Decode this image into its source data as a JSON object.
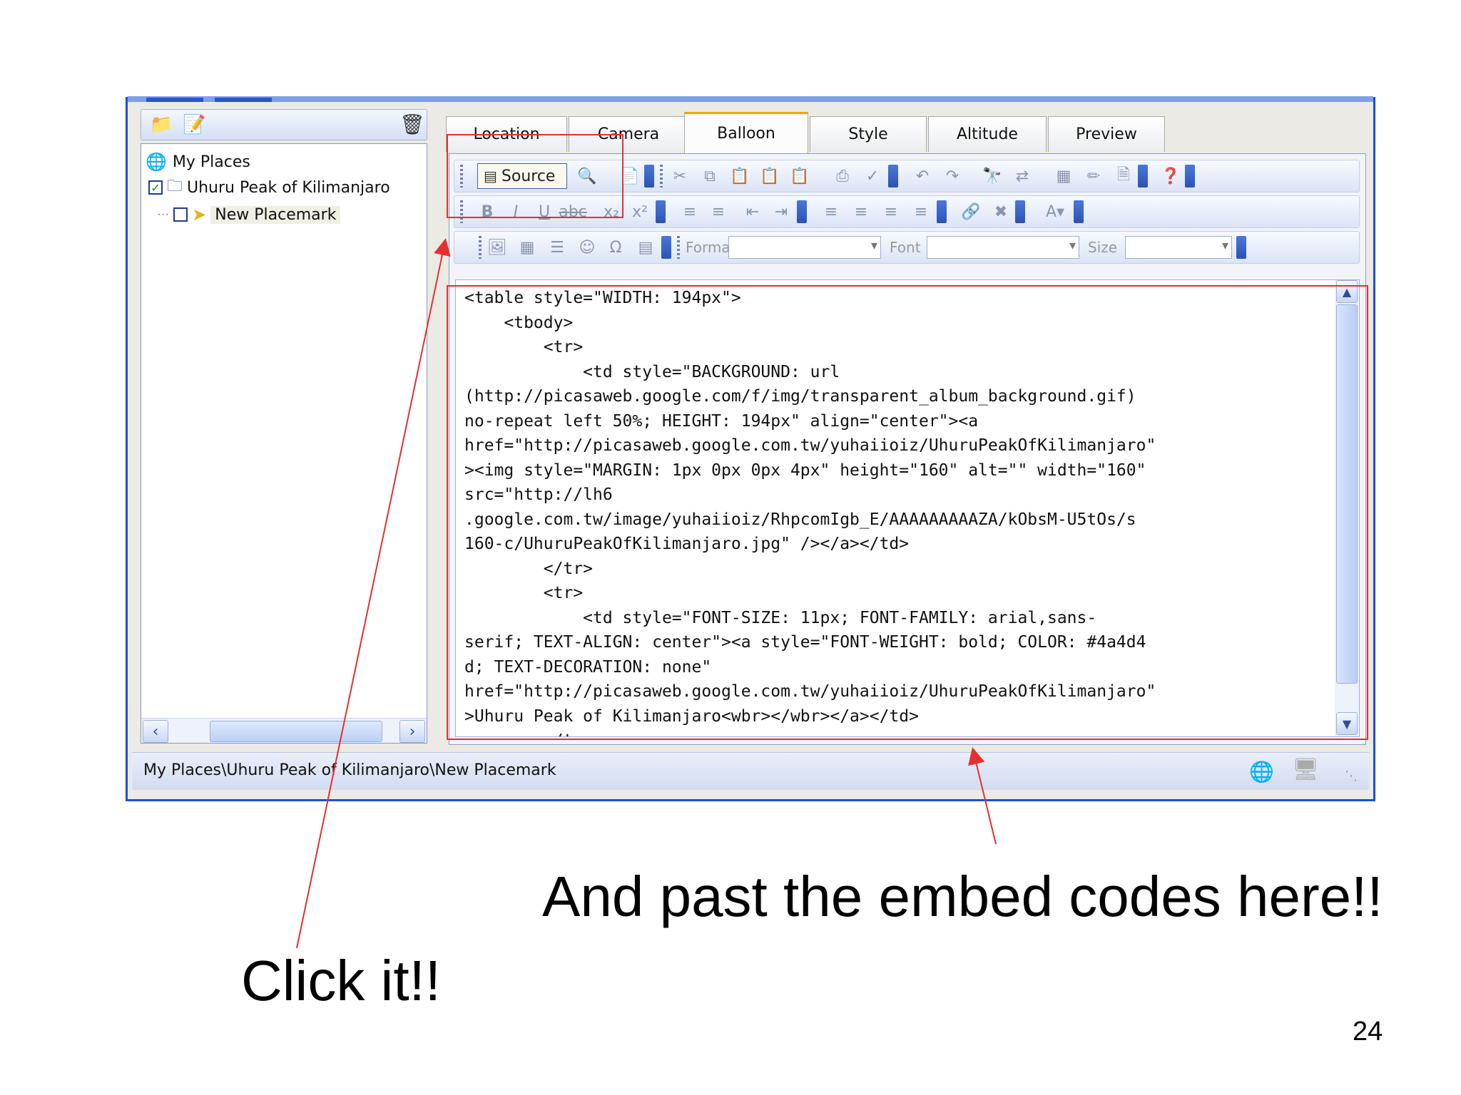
{
  "left_panel": {
    "tree": [
      {
        "label": "My Places"
      },
      {
        "label": "Uhuru Peak of Kilimanjaro",
        "checked": true
      },
      {
        "label": "New Placemark",
        "checked": false
      }
    ]
  },
  "tabs": [
    {
      "label": "Location"
    },
    {
      "label": "Camera"
    },
    {
      "label": "Balloon",
      "active": true
    },
    {
      "label": "Style"
    },
    {
      "label": "Altitude"
    },
    {
      "label": "Preview"
    }
  ],
  "toolbar": {
    "source_label": "Source",
    "format_label": "Format",
    "font_label": "Font",
    "size_label": "Size"
  },
  "code_lines": [
    "<table style=\"WIDTH: 194px\">",
    "    <tbody>",
    "        <tr>",
    "            <td style=\"BACKGROUND: url",
    "(http://picasaweb.google.com/f/img/transparent_album_background.gif)",
    "no-repeat left 50%; HEIGHT: 194px\" align=\"center\"><a",
    "href=\"http://picasaweb.google.com.tw/yuhaiioiz/UhuruPeakOfKilimanjaro\"",
    "><img style=\"MARGIN: 1px 0px 0px 4px\" height=\"160\" alt=\"\" width=\"160\"",
    "src=\"http://lh6",
    ".google.com.tw/image/yuhaiioiz/RhpcomIgb_E/AAAAAAAAAZA/kObsM-U5tOs/s",
    "160-c/UhuruPeakOfKilimanjaro.jpg\" /></a></td>",
    "        </tr>",
    "        <tr>",
    "            <td style=\"FONT-SIZE: 11px; FONT-FAMILY: arial,sans-",
    "serif; TEXT-ALIGN: center\"><a style=\"FONT-WEIGHT: bold; COLOR: #4a4d4",
    "d; TEXT-DECORATION: none\"",
    "href=\"http://picasaweb.google.com.tw/yuhaiioiz/UhuruPeakOfKilimanjaro\"",
    ">Uhuru Peak of Kilimanjaro<wbr></wbr></a></td>",
    "        </tr>"
  ],
  "status_bar": {
    "path": "My Places\\Uhuru Peak of Kilimanjaro\\New Placemark"
  },
  "annotations": {
    "embed_caption": "And past the embed codes here!!",
    "click_caption": "Click it!!"
  },
  "page_number": "24",
  "colors": {
    "highlight": "#e53030",
    "window_border": "#1c4fd6",
    "active_tab_accent": "#f3a600"
  }
}
